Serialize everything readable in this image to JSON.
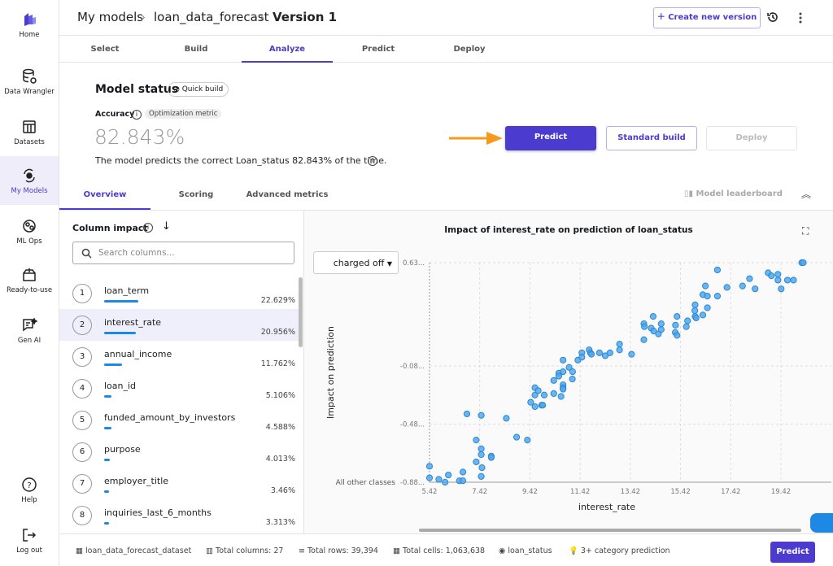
{
  "sidebar": {
    "items": [
      {
        "label": "Home"
      },
      {
        "label": "Data Wrangler"
      },
      {
        "label": "Datasets"
      },
      {
        "label": "My Models"
      },
      {
        "label": "ML Ops"
      },
      {
        "label": "Ready-to-use"
      },
      {
        "label": "Gen AI"
      },
      {
        "label": "Help"
      },
      {
        "label": "Log out"
      }
    ]
  },
  "header": {
    "breadcrumb": [
      "My models",
      "loan_data_forecast",
      "Version 1"
    ],
    "create_label": "Create new version"
  },
  "steps": [
    "Select",
    "Build",
    "Analyze",
    "Predict",
    "Deploy"
  ],
  "status": {
    "title": "Model status",
    "badge": "Quick build",
    "metric_label": "Accuracy",
    "metric_badge": "Optimization metric",
    "value": "82.843%",
    "sentence": "The model predicts the correct Loan_status 82.843% of the time."
  },
  "actions": {
    "predict": "Predict",
    "standard": "Standard build",
    "deploy": "Deploy"
  },
  "subtabs": [
    "Overview",
    "Scoring",
    "Advanced metrics"
  ],
  "leaderboard": "Model leaderboard",
  "columns": {
    "title": "Column impact",
    "search_placeholder": "Search columns...",
    "items": [
      {
        "n": "1",
        "name": "loan_term",
        "pct": "22.629%",
        "v": 22.629
      },
      {
        "n": "2",
        "name": "interest_rate",
        "pct": "20.956%",
        "v": 20.956
      },
      {
        "n": "3",
        "name": "annual_income",
        "pct": "11.762%",
        "v": 11.762
      },
      {
        "n": "4",
        "name": "loan_id",
        "pct": "5.106%",
        "v": 5.106
      },
      {
        "n": "5",
        "name": "funded_amount_by_investors",
        "pct": "4.588%",
        "v": 4.588
      },
      {
        "n": "6",
        "name": "purpose",
        "pct": "4.013%",
        "v": 4.013
      },
      {
        "n": "7",
        "name": "employer_title",
        "pct": "3.46%",
        "v": 3.46
      },
      {
        "n": "8",
        "name": "inquiries_last_6_months",
        "pct": "3.313%",
        "v": 3.313
      }
    ]
  },
  "class_select": "charged off",
  "chart_data": {
    "type": "scatter",
    "title": "Impact of interest_rate on prediction of loan_status",
    "xlabel": "interest_rate",
    "ylabel": "Impact on prediction",
    "baseline_label": "All other classes",
    "xticks": [
      "5.42",
      "7.42",
      "9.42",
      "11.42",
      "13.42",
      "15.42",
      "17.42",
      "19.42"
    ],
    "xtick_values": [
      5.42,
      7.42,
      9.42,
      11.42,
      13.42,
      15.42,
      17.42,
      19.42
    ],
    "yticks": [
      "0.63...",
      "-0.08...",
      "-0.48...",
      "-0.88..."
    ],
    "ytick_values": [
      0.63,
      -0.08,
      -0.48,
      -0.88
    ],
    "xlim": [
      5.42,
      20.7
    ],
    "ylim": [
      -0.88,
      0.63
    ],
    "grid": true,
    "color": "#4fa8ea",
    "points": [
      [
        5.42,
        -0.77
      ],
      [
        5.42,
        -0.85
      ],
      [
        5.79,
        -0.86
      ],
      [
        6.04,
        -0.88
      ],
      [
        6.17,
        -0.83
      ],
      [
        6.61,
        -0.87
      ],
      [
        6.75,
        -0.87
      ],
      [
        6.75,
        -0.81
      ],
      [
        6.91,
        -0.41
      ],
      [
        7.28,
        -0.59
      ],
      [
        7.28,
        -0.74
      ],
      [
        7.48,
        -0.42
      ],
      [
        7.48,
        -0.65
      ],
      [
        7.48,
        -0.69
      ],
      [
        7.51,
        -0.78
      ],
      [
        7.48,
        -0.84
      ],
      [
        7.88,
        -0.7
      ],
      [
        7.88,
        -0.71
      ],
      [
        8.48,
        -0.44
      ],
      [
        8.89,
        -0.57
      ],
      [
        9.32,
        -0.59
      ],
      [
        9.45,
        -0.33
      ],
      [
        9.62,
        -0.23
      ],
      [
        9.62,
        -0.28
      ],
      [
        9.62,
        -0.36
      ],
      [
        9.75,
        -0.25
      ],
      [
        9.89,
        -0.35
      ],
      [
        9.93,
        -0.35
      ],
      [
        9.99,
        -0.28
      ],
      [
        10.37,
        -0.18
      ],
      [
        10.37,
        -0.27
      ],
      [
        10.57,
        -0.13
      ],
      [
        10.57,
        -0.15
      ],
      [
        10.66,
        -0.29
      ],
      [
        10.74,
        -0.04
      ],
      [
        10.74,
        -0.12
      ],
      [
        10.74,
        -0.21
      ],
      [
        10.74,
        -0.23
      ],
      [
        10.74,
        -0.24
      ],
      [
        10.98,
        -0.09
      ],
      [
        11.12,
        -0.12
      ],
      [
        11.11,
        -0.17
      ],
      [
        11.33,
        -0.04
      ],
      [
        11.49,
        0.01
      ],
      [
        11.49,
        -0.02
      ],
      [
        11.78,
        0.03
      ],
      [
        11.83,
        0.01
      ],
      [
        11.87,
        0.0
      ],
      [
        12.19,
        0.01
      ],
      [
        12.42,
        -0.01
      ],
      [
        12.61,
        0.01
      ],
      [
        12.99,
        0.07
      ],
      [
        12.99,
        0.03
      ],
      [
        13.47,
        0.0
      ],
      [
        13.96,
        0.21
      ],
      [
        13.98,
        0.19
      ],
      [
        13.96,
        0.1
      ],
      [
        14.25,
        0.18
      ],
      [
        14.35,
        0.16
      ],
      [
        14.33,
        0.26
      ],
      [
        14.54,
        0.14
      ],
      [
        14.65,
        0.21
      ],
      [
        14.65,
        0.17
      ],
      [
        15.21,
        0.15
      ],
      [
        15.28,
        0.13
      ],
      [
        15.22,
        0.2
      ],
      [
        15.28,
        0.26
      ],
      [
        15.65,
        0.19
      ],
      [
        15.7,
        0.23
      ],
      [
        16.0,
        0.34
      ],
      [
        15.99,
        0.3
      ],
      [
        16.0,
        0.26
      ],
      [
        16.04,
        0.25
      ],
      [
        16.31,
        0.27
      ],
      [
        16.31,
        0.41
      ],
      [
        16.41,
        0.47
      ],
      [
        16.49,
        0.4
      ],
      [
        16.49,
        0.32
      ],
      [
        16.89,
        0.58
      ],
      [
        16.89,
        0.4
      ],
      [
        17.27,
        0.46
      ],
      [
        17.89,
        0.47
      ],
      [
        18.17,
        0.52
      ],
      [
        18.39,
        0.45
      ],
      [
        18.91,
        0.56
      ],
      [
        19.04,
        0.54
      ],
      [
        19.3,
        0.55
      ],
      [
        19.3,
        0.51
      ],
      [
        19.43,
        0.45
      ],
      [
        19.68,
        0.51
      ],
      [
        19.92,
        0.51
      ],
      [
        20.25,
        0.63
      ],
      [
        20.31,
        0.63
      ]
    ]
  },
  "footer": {
    "dataset": "loan_data_forecast_dataset",
    "columns": "Total columns: 27",
    "rows": "Total rows: 39,394",
    "cells": "Total cells: 1,063,638",
    "target": "loan_status",
    "type": "3+ category prediction",
    "predict": "Predict"
  }
}
